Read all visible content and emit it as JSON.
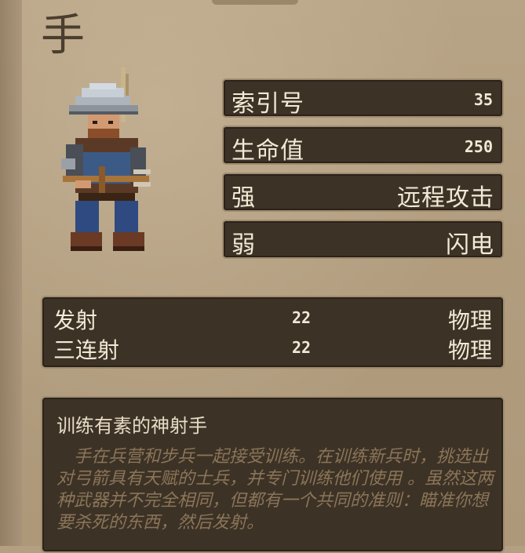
{
  "unit": {
    "name": "手"
  },
  "stats": {
    "index_label": "索引号",
    "index_value": "35",
    "hp_label": "生命值",
    "hp_value": "250",
    "strong_label": "强",
    "strong_value": "远程攻击",
    "weak_label": "弱",
    "weak_value": "闪电"
  },
  "attacks": [
    {
      "name": "发射",
      "damage": "22",
      "type": "物理"
    },
    {
      "name": "三连射",
      "damage": "22",
      "type": "物理"
    }
  ],
  "description": {
    "title": "训练有素的神射手",
    "body": "手在兵营和步兵一起接受训练。在训练新兵时，挑选出对弓箭具有天赋的士兵，并专门训练他们使用 。虽然这两种武器并不完全相同，但都有一个共同的准则：瞄准你想要杀死的东西，然后发射。"
  },
  "colors": {
    "panel_bg": "#3d3226",
    "panel_border": "#a08c6e",
    "parchment": "#b39f82",
    "text_light": "#f2e9d6",
    "text_faded": "#8a7558"
  },
  "icons": {
    "portrait": "crossbowman-portrait"
  }
}
